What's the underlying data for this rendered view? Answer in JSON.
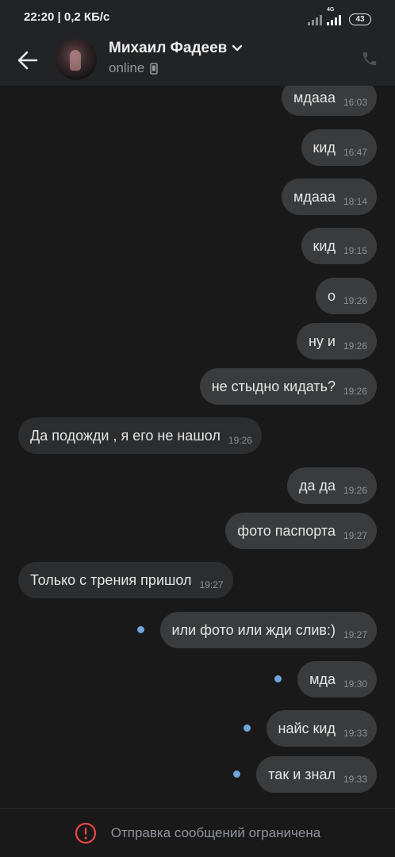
{
  "status_bar": {
    "time_and_speed": "22:20 | 0,2 КБ/с",
    "network_label": "4G",
    "battery": "43"
  },
  "header": {
    "contact_name": "Михаил Фадеев",
    "status": "online",
    "icons": [
      "back-arrow-icon",
      "chevron-down-icon",
      "phone-device-icon",
      "phone-call-icon"
    ]
  },
  "messages": [
    {
      "dir": "out",
      "text": "мдааа",
      "time": "16:03",
      "unread": false
    },
    {
      "dir": "out",
      "text": "кид",
      "time": "16:47",
      "unread": false
    },
    {
      "dir": "out",
      "text": "мдааа",
      "time": "18:14",
      "unread": false
    },
    {
      "dir": "out",
      "text": "кид",
      "time": "19:15",
      "unread": false
    },
    {
      "dir": "out",
      "text": "о",
      "time": "19:26",
      "unread": false
    },
    {
      "dir": "out",
      "text": "ну и",
      "time": "19:26",
      "unread": false
    },
    {
      "dir": "out",
      "text": "не стыдно кидать?",
      "time": "19:26",
      "unread": false
    },
    {
      "dir": "in",
      "text": "Да подожди , я его не нашол",
      "time": "19:26",
      "unread": false
    },
    {
      "dir": "out",
      "text": "да да",
      "time": "19:26",
      "unread": false
    },
    {
      "dir": "out",
      "text": "фото паспорта",
      "time": "19:27",
      "unread": false
    },
    {
      "dir": "in",
      "text": "Только с трения пришол",
      "time": "19:27",
      "unread": false
    },
    {
      "dir": "out",
      "text": "или фото или жди слив:)",
      "time": "19:27",
      "unread": true
    },
    {
      "dir": "out",
      "text": "мда",
      "time": "19:30",
      "unread": true
    },
    {
      "dir": "out",
      "text": "найс кид",
      "time": "19:33",
      "unread": true
    },
    {
      "dir": "out",
      "text": "так и знал",
      "time": "19:33",
      "unread": true
    }
  ],
  "footer": {
    "notice": "Отправка сообщений ограничена",
    "icon": "alert-circle-icon",
    "icon_color": "#e64646"
  },
  "colors": {
    "background": "#19191a",
    "bar": "#222325",
    "outgoing_bubble": "#3a3b3c",
    "incoming_bubble": "#2c2d2e",
    "unread_dot": "#71a4da"
  }
}
